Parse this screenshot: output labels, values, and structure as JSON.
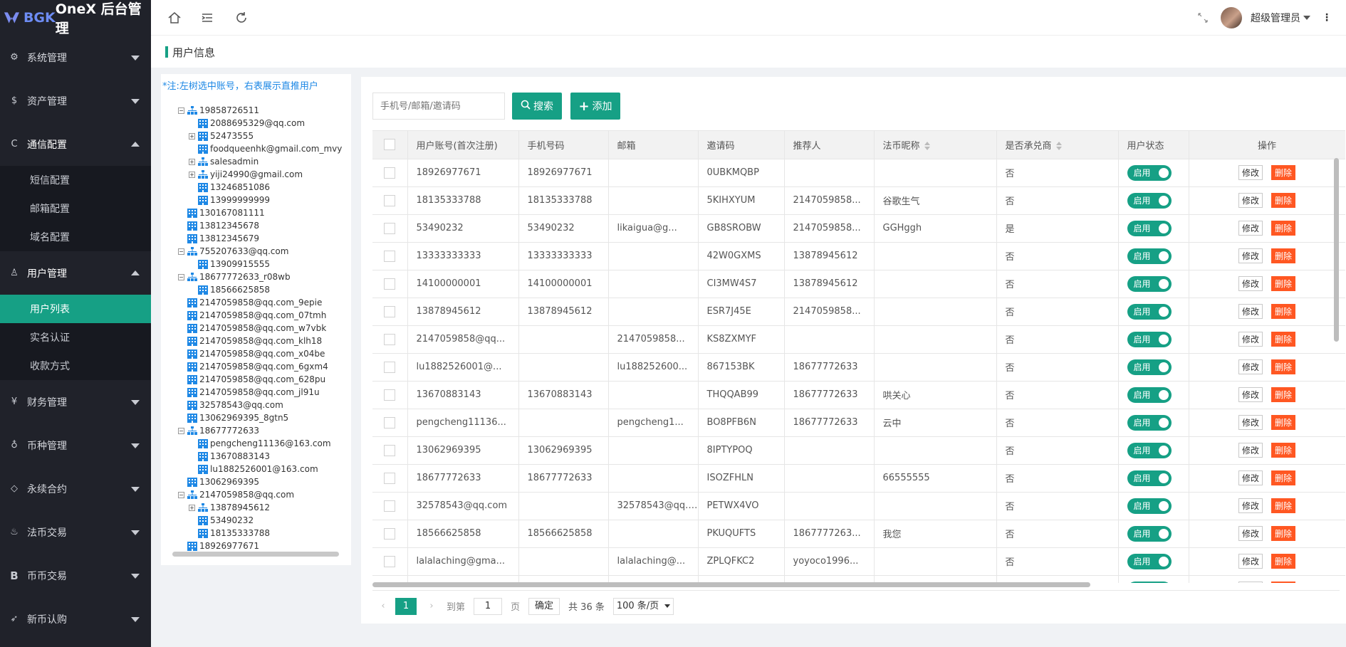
{
  "app": {
    "brand_prefix": "BGK",
    "brand_suffix": " OneX 后台管理",
    "user_name": "超级管理员"
  },
  "sidebar": {
    "items": [
      {
        "label": "系统管理",
        "icon": "gear-icon",
        "open": false
      },
      {
        "label": "资产管理",
        "icon": "dollar-icon",
        "open": false
      },
      {
        "label": "通信配置",
        "icon": "communication-icon",
        "open": true,
        "children": [
          "短信配置",
          "邮箱配置",
          "域名配置"
        ]
      },
      {
        "label": "用户管理",
        "icon": "user-icon",
        "open": true,
        "children": [
          "用户列表",
          "实名认证",
          "收款方式"
        ],
        "active_child": "用户列表"
      },
      {
        "label": "财务管理",
        "icon": "yen-icon",
        "open": false
      },
      {
        "label": "币种管理",
        "icon": "coin-icon",
        "open": false
      },
      {
        "label": "永续合约",
        "icon": "diamond-icon",
        "open": false
      },
      {
        "label": "法币交易",
        "icon": "fire-icon",
        "open": false
      },
      {
        "label": "币币交易",
        "icon": "b-icon",
        "open": false
      },
      {
        "label": "新币认购",
        "icon": "rocket-icon",
        "open": false
      }
    ]
  },
  "page": {
    "title": "用户信息"
  },
  "tree": {
    "note": "*注:左树选中账号，右表展示直推用户",
    "nodes": [
      {
        "label": "19858726511",
        "level": 0,
        "toggle": "minus",
        "type": "group"
      },
      {
        "label": "2088695329@qq.com",
        "level": 1,
        "toggle": "",
        "type": "leaf"
      },
      {
        "label": "52473555",
        "level": 1,
        "toggle": "plus",
        "type": "leaf"
      },
      {
        "label": "foodqueenhk@gmail.com_mvy",
        "level": 1,
        "toggle": "",
        "type": "leaf"
      },
      {
        "label": "salesadmin",
        "level": 1,
        "toggle": "plus",
        "type": "group"
      },
      {
        "label": "yiji24990@gmail.com",
        "level": 1,
        "toggle": "plus",
        "type": "group"
      },
      {
        "label": "13246851086",
        "level": 1,
        "toggle": "",
        "type": "leaf"
      },
      {
        "label": "13999999999",
        "level": 1,
        "toggle": "",
        "type": "leaf"
      },
      {
        "label": "130167081111",
        "level": 0,
        "toggle": "",
        "type": "leaf"
      },
      {
        "label": "13812345678",
        "level": 0,
        "toggle": "",
        "type": "leaf"
      },
      {
        "label": "13812345679",
        "level": 0,
        "toggle": "",
        "type": "leaf"
      },
      {
        "label": "755207633@qq.com",
        "level": 0,
        "toggle": "minus",
        "type": "group"
      },
      {
        "label": "13909915555",
        "level": 1,
        "toggle": "",
        "type": "leaf"
      },
      {
        "label": "18677772633_r08wb",
        "level": 0,
        "toggle": "minus",
        "type": "group"
      },
      {
        "label": "18566625858",
        "level": 1,
        "toggle": "",
        "type": "leaf"
      },
      {
        "label": "2147059858@qq.com_9epie",
        "level": 0,
        "toggle": "",
        "type": "leaf"
      },
      {
        "label": "2147059858@qq.com_07tmh",
        "level": 0,
        "toggle": "",
        "type": "leaf"
      },
      {
        "label": "2147059858@qq.com_w7vbk",
        "level": 0,
        "toggle": "",
        "type": "leaf"
      },
      {
        "label": "2147059858@qq.com_klh18",
        "level": 0,
        "toggle": "",
        "type": "leaf"
      },
      {
        "label": "2147059858@qq.com_x04be",
        "level": 0,
        "toggle": "",
        "type": "leaf"
      },
      {
        "label": "2147059858@qq.com_6gxm4",
        "level": 0,
        "toggle": "",
        "type": "leaf"
      },
      {
        "label": "2147059858@qq.com_628pu",
        "level": 0,
        "toggle": "",
        "type": "leaf"
      },
      {
        "label": "2147059858@qq.com_jl91u",
        "level": 0,
        "toggle": "",
        "type": "leaf"
      },
      {
        "label": "32578543@qq.com",
        "level": 0,
        "toggle": "",
        "type": "leaf"
      },
      {
        "label": "13062969395_8gtn5",
        "level": 0,
        "toggle": "",
        "type": "leaf"
      },
      {
        "label": "18677772633",
        "level": 0,
        "toggle": "minus",
        "type": "group"
      },
      {
        "label": "pengcheng11136@163.com",
        "level": 1,
        "toggle": "",
        "type": "leaf"
      },
      {
        "label": "13670883143",
        "level": 1,
        "toggle": "",
        "type": "leaf"
      },
      {
        "label": "lu1882526001@163.com",
        "level": 1,
        "toggle": "",
        "type": "leaf"
      },
      {
        "label": "13062969395",
        "level": 0,
        "toggle": "",
        "type": "leaf"
      },
      {
        "label": "2147059858@qq.com",
        "level": 0,
        "toggle": "minus",
        "type": "group"
      },
      {
        "label": "13878945612",
        "level": 1,
        "toggle": "plus",
        "type": "group"
      },
      {
        "label": "53490232",
        "level": 1,
        "toggle": "",
        "type": "leaf"
      },
      {
        "label": "18135333788",
        "level": 1,
        "toggle": "",
        "type": "leaf"
      },
      {
        "label": "18926977671",
        "level": 0,
        "toggle": "",
        "type": "leaf"
      }
    ]
  },
  "search": {
    "placeholder": "手机号/邮箱/邀请码",
    "search_label": "搜索",
    "add_label": "添加"
  },
  "table": {
    "columns": [
      "用户账号(首次注册)",
      "手机号码",
      "邮箱",
      "邀请码",
      "推荐人",
      "法币昵称",
      "是否承兑商",
      "用户状态",
      "操作"
    ],
    "status_label": "启用",
    "edit_label": "修改",
    "delete_label": "删除",
    "rows": [
      {
        "account": "18926977671",
        "phone": "18926977671",
        "email": "",
        "invite": "0UBKMQBP",
        "referrer": "",
        "nickname": "",
        "acceptor": "否"
      },
      {
        "account": "18135333788",
        "phone": "18135333788",
        "email": "",
        "invite": "5KIHXYUM",
        "referrer": "2147059858...",
        "nickname": "谷歌生气",
        "acceptor": "否"
      },
      {
        "account": "53490232",
        "phone": "53490232",
        "email": "likaigua@g...",
        "invite": "GB8SROBW",
        "referrer": "2147059858...",
        "nickname": "GGHggh",
        "acceptor": "是"
      },
      {
        "account": "13333333333",
        "phone": "13333333333",
        "email": "",
        "invite": "42W0GXMS",
        "referrer": "13878945612",
        "nickname": "",
        "acceptor": "否"
      },
      {
        "account": "14100000001",
        "phone": "14100000001",
        "email": "",
        "invite": "CI3MW4S7",
        "referrer": "13878945612",
        "nickname": "",
        "acceptor": "否"
      },
      {
        "account": "13878945612",
        "phone": "13878945612",
        "email": "",
        "invite": "ESR7J45E",
        "referrer": "2147059858...",
        "nickname": "",
        "acceptor": "否"
      },
      {
        "account": "2147059858@qq...",
        "phone": "",
        "email": "2147059858...",
        "invite": "KS8ZXMYF",
        "referrer": "",
        "nickname": "",
        "acceptor": "否"
      },
      {
        "account": "lu1882526001@...",
        "phone": "",
        "email": "lu188252600...",
        "invite": "867153BK",
        "referrer": "18677772633",
        "nickname": "",
        "acceptor": "否"
      },
      {
        "account": "13670883143",
        "phone": "13670883143",
        "email": "",
        "invite": "THQQAB99",
        "referrer": "18677772633",
        "nickname": "哄关心",
        "acceptor": "否"
      },
      {
        "account": "pengcheng11136...",
        "phone": "",
        "email": "pengcheng1...",
        "invite": "BO8PFB6N",
        "referrer": "18677772633",
        "nickname": "云中",
        "acceptor": "否"
      },
      {
        "account": "13062969395",
        "phone": "13062969395",
        "email": "",
        "invite": "8IPTYPOQ",
        "referrer": "",
        "nickname": "",
        "acceptor": "否"
      },
      {
        "account": "18677772633",
        "phone": "18677772633",
        "email": "",
        "invite": "ISOZFHLN",
        "referrer": "",
        "nickname": "66555555",
        "acceptor": "否"
      },
      {
        "account": "32578543@qq.com",
        "phone": "",
        "email": "32578543@qq.com",
        "invite": "PETWX4VO",
        "referrer": "",
        "nickname": "",
        "acceptor": "否"
      },
      {
        "account": "18566625858",
        "phone": "18566625858",
        "email": "",
        "invite": "PKUQUFTS",
        "referrer": "1867777263...",
        "nickname": "我您",
        "acceptor": "否"
      },
      {
        "account": "lalalaching@gma...",
        "phone": "",
        "email": "lalalaching@...",
        "invite": "ZPLQFKC2",
        "referrer": "yoyoco1996...",
        "nickname": "",
        "acceptor": "否"
      },
      {
        "account": "",
        "phone": "",
        "email": "",
        "invite": "",
        "referrer": "",
        "nickname": "",
        "acceptor": ""
      }
    ]
  },
  "pager": {
    "current_page": "1",
    "goto_label": "到第",
    "goto_value": "1",
    "page_unit": "页",
    "confirm_label": "确定",
    "total_text": "共 36 条",
    "page_size": "100 条/页"
  },
  "colors": {
    "accent": "#16a085",
    "sidebar_bg": "#20222a",
    "danger": "#ff5722"
  }
}
